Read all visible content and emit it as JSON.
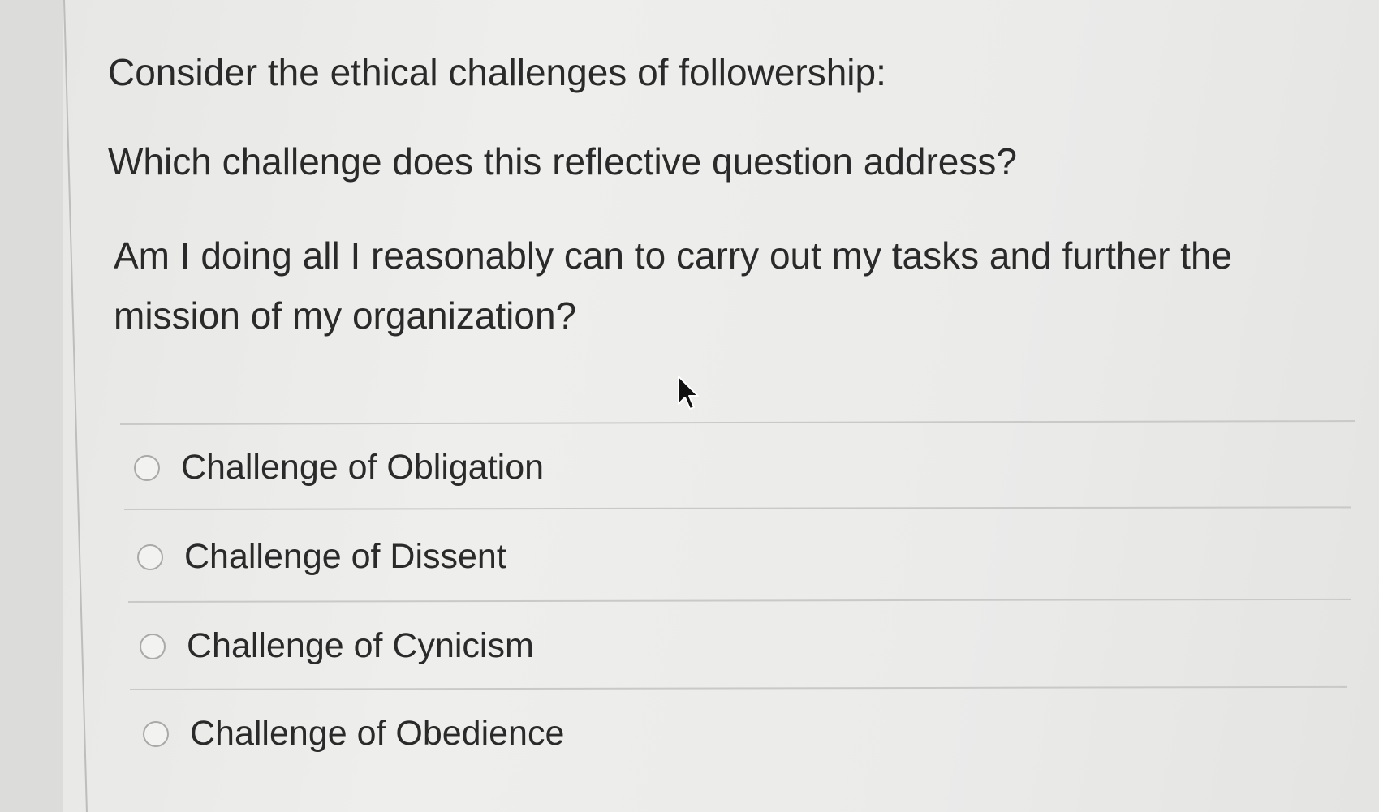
{
  "question": {
    "intro": "Consider the ethical challenges of followership:",
    "prompt": "Which challenge does this reflective question address?",
    "reflective_question": "Am I doing all I reasonably can to carry out my tasks and further the mission of my organization?"
  },
  "options": [
    {
      "label": "Challenge of Obligation",
      "selected": false
    },
    {
      "label": "Challenge of Dissent",
      "selected": false
    },
    {
      "label": "Challenge of Cynicism",
      "selected": false
    },
    {
      "label": "Challenge of Obedience",
      "selected": false
    }
  ],
  "icons": {
    "radio": "radio-button-icon",
    "cursor": "mouse-pointer-icon"
  },
  "colors": {
    "background": "#ebebea",
    "text": "#2a2a2a",
    "divider": "#c9c9c7",
    "radio_border": "#a9a9a7"
  }
}
